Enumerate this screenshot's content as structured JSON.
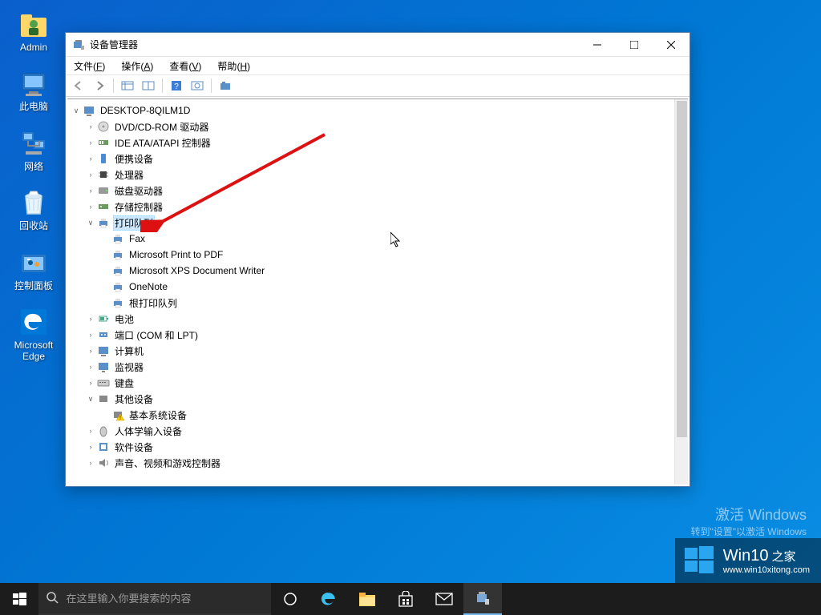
{
  "desktop": {
    "icons": [
      {
        "label": "Admin"
      },
      {
        "label": "此电脑"
      },
      {
        "label": "网络"
      },
      {
        "label": "回收站"
      },
      {
        "label": "控制面板"
      },
      {
        "label": "Microsoft\nEdge"
      }
    ]
  },
  "window": {
    "title": "设备管理器",
    "menu": {
      "file": "文件",
      "file_hk": "F",
      "action": "操作",
      "action_hk": "A",
      "view": "查看",
      "view_hk": "V",
      "help": "帮助",
      "help_hk": "H"
    }
  },
  "tree": {
    "root": "DESKTOP-8QILM1D",
    "nodes": [
      {
        "label": "DVD/CD-ROM 驱动器",
        "expanded": false,
        "icon": "disc"
      },
      {
        "label": "IDE ATA/ATAPI 控制器",
        "expanded": false,
        "icon": "ide"
      },
      {
        "label": "便携设备",
        "expanded": false,
        "icon": "portable"
      },
      {
        "label": "处理器",
        "expanded": false,
        "icon": "cpu"
      },
      {
        "label": "磁盘驱动器",
        "expanded": false,
        "icon": "disk"
      },
      {
        "label": "存储控制器",
        "expanded": false,
        "icon": "storage"
      },
      {
        "label": "打印队列",
        "expanded": true,
        "selected": true,
        "icon": "printer",
        "children": [
          {
            "label": "Fax",
            "icon": "printer"
          },
          {
            "label": "Microsoft Print to PDF",
            "icon": "printer"
          },
          {
            "label": "Microsoft XPS Document Writer",
            "icon": "printer"
          },
          {
            "label": "OneNote",
            "icon": "printer"
          },
          {
            "label": "根打印队列",
            "icon": "printer"
          }
        ]
      },
      {
        "label": "电池",
        "expanded": false,
        "icon": "battery"
      },
      {
        "label": "端口 (COM 和 LPT)",
        "expanded": false,
        "icon": "port"
      },
      {
        "label": "计算机",
        "expanded": false,
        "icon": "computer"
      },
      {
        "label": "监视器",
        "expanded": false,
        "icon": "monitor"
      },
      {
        "label": "键盘",
        "expanded": false,
        "icon": "keyboard"
      },
      {
        "label": "其他设备",
        "expanded": true,
        "icon": "other",
        "children": [
          {
            "label": "基本系统设备",
            "icon": "warning"
          }
        ]
      },
      {
        "label": "人体学输入设备",
        "expanded": false,
        "icon": "hid"
      },
      {
        "label": "软件设备",
        "expanded": false,
        "icon": "software"
      },
      {
        "label": "声音、视频和游戏控制器",
        "expanded": false,
        "icon": "sound"
      }
    ]
  },
  "activation": {
    "line1": "激活 Windows",
    "line2": "转到\"设置\"以激活 Windows"
  },
  "watermark": {
    "title_main": "Win10",
    "title_suffix": "之家",
    "url": "www.win10xitong.com"
  },
  "taskbar": {
    "search_placeholder": "在这里输入你要搜索的内容"
  }
}
